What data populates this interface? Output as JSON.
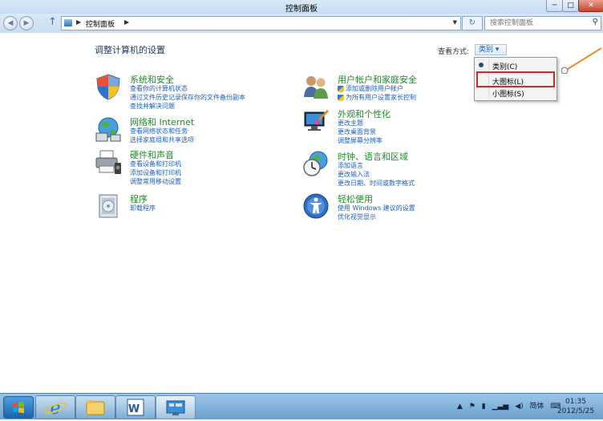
{
  "window": {
    "title": "控制面板",
    "minimize": "─",
    "maximize": "□",
    "close": "✕"
  },
  "address": {
    "breadcrumb": "控制面板",
    "search_placeholder": "搜索控制面板"
  },
  "main": {
    "heading": "调整计算机的设置",
    "view_by_label": "查看方式:",
    "view_by_value": "类别 ▾"
  },
  "categories": [
    {
      "title": "系统和安全",
      "icon": "shield-icon",
      "links": [
        "查看你的计算机状态",
        "通过文件历史记录保存你的文件备份副本",
        "查找并解决问题"
      ]
    },
    {
      "title": "网络和 Internet",
      "icon": "network-globe-icon",
      "links": [
        "查看网络状态和任务",
        "选择家庭组和共享选项"
      ]
    },
    {
      "title": "硬件和声音",
      "icon": "printer-icon",
      "links": [
        "查看设备和打印机",
        "添加设备和打印机",
        "调整常用移动设置"
      ]
    },
    {
      "title": "程序",
      "icon": "programs-icon",
      "links": [
        "卸载程序"
      ]
    },
    {
      "title": "用户帐户和家庭安全",
      "icon": "users-icon",
      "links": [
        "添加或删除用户帐户",
        "为所有用户设置家长控制"
      ]
    },
    {
      "title": "外观和个性化",
      "icon": "monitor-brush-icon",
      "links": [
        "更改主题",
        "更改桌面背景",
        "调整屏幕分辨率"
      ]
    },
    {
      "title": "时钟、语言和区域",
      "icon": "clock-globe-icon",
      "links": [
        "添加语言",
        "更改输入法",
        "更改日期、时间或数字格式"
      ]
    },
    {
      "title": "轻松使用",
      "icon": "ease-of-access-icon",
      "links": [
        "使用 Windows 建议的设置",
        "优化视觉显示"
      ]
    }
  ],
  "view_menu": {
    "items": [
      "类别(C)",
      "大图标(L)",
      "小图标(S)"
    ],
    "selected": "类别(C)",
    "highlighted": "大图标(L)"
  },
  "taskbar": {
    "apps": [
      "ie-icon",
      "explorer-icon",
      "word-icon",
      "control-panel-icon"
    ],
    "ime": "简体",
    "time": "01:35",
    "date": "2012/5/25"
  },
  "colors": {
    "accent": "#1b5fbf",
    "category_title": "#1e8a2a",
    "highlight_box": "#d22a2a",
    "arrow": "#f08a24"
  }
}
